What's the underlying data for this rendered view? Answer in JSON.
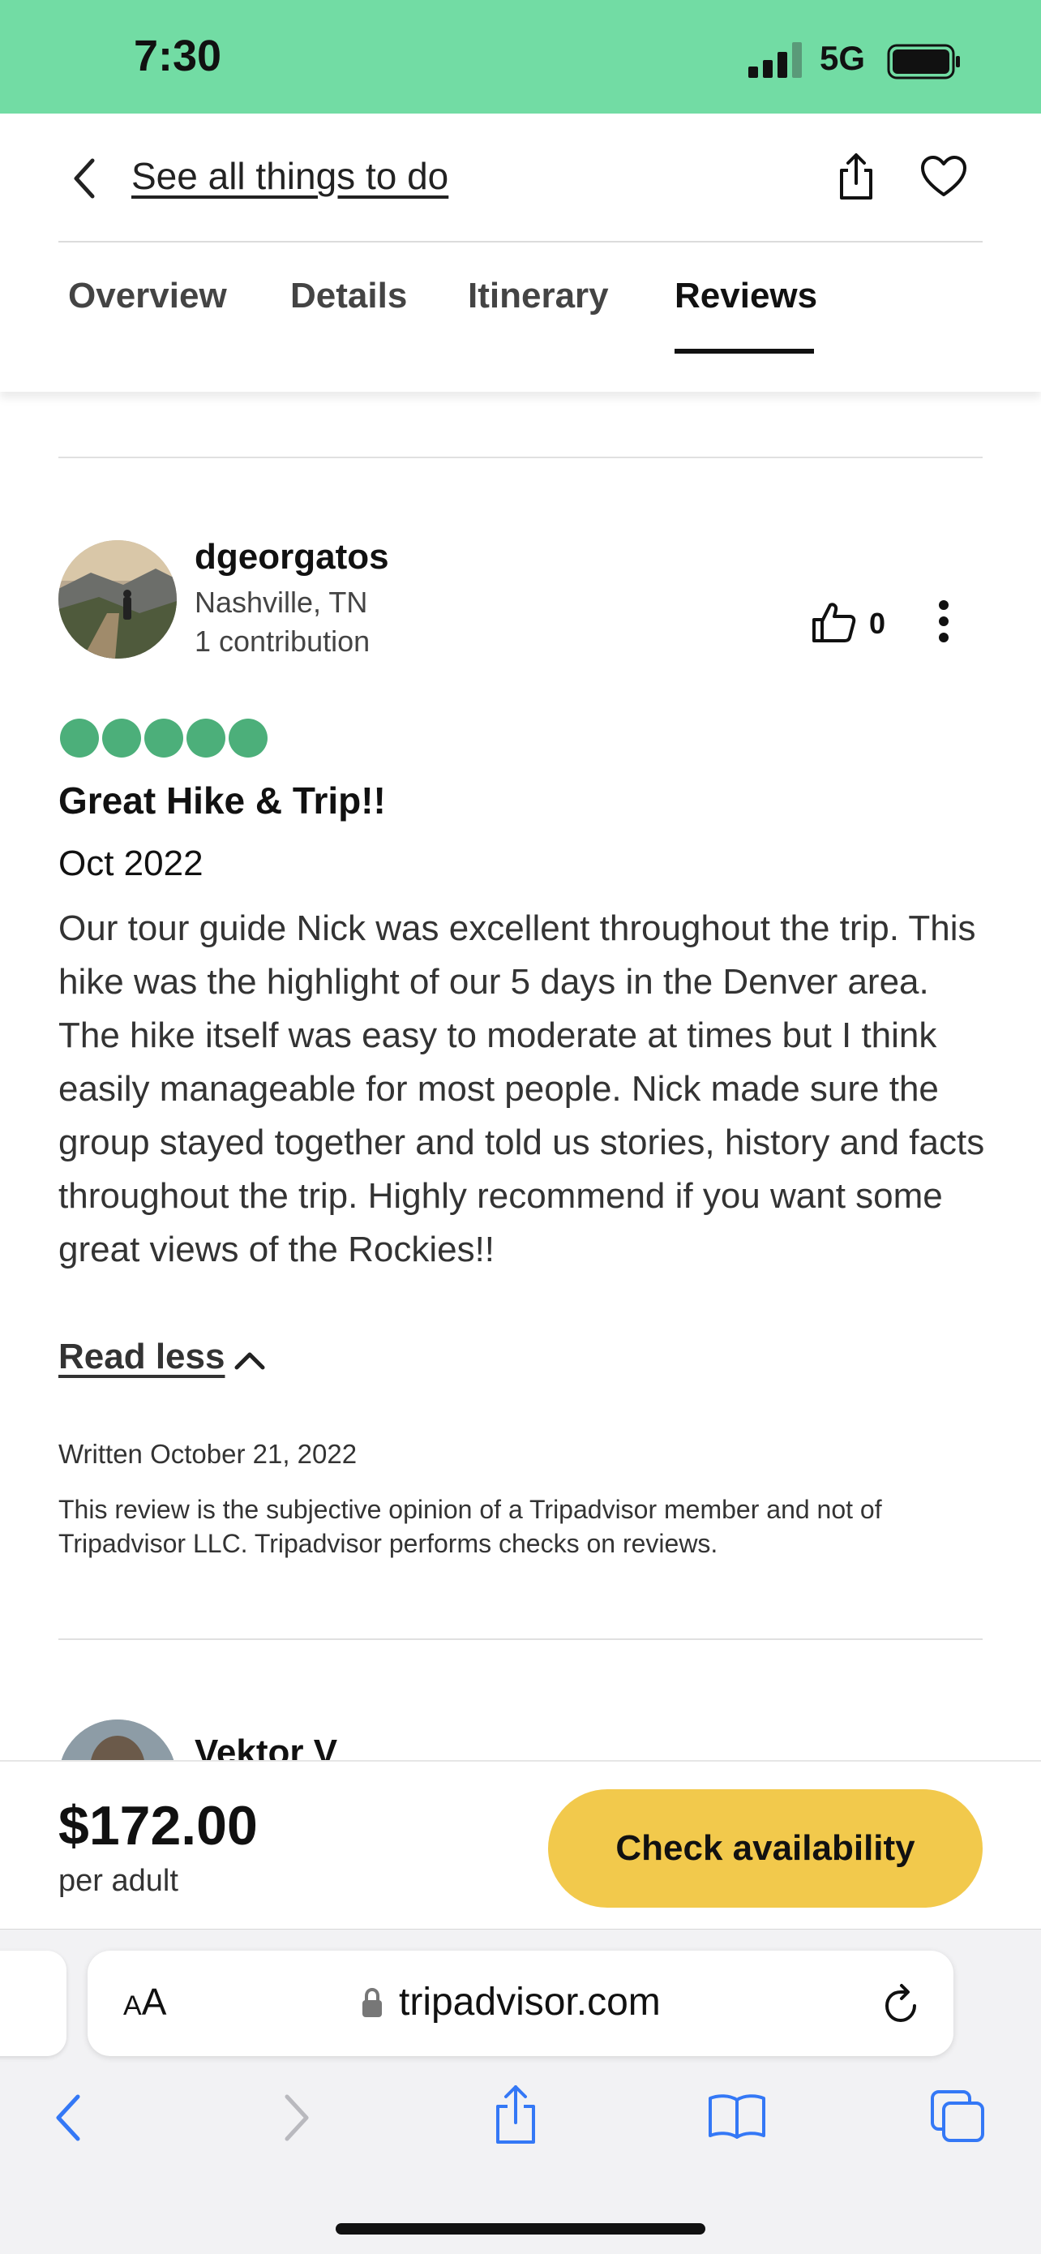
{
  "status_bar": {
    "time": "7:30",
    "network": "5G",
    "background_color": "#72dca4"
  },
  "header": {
    "back_label": "See all things to do",
    "tabs": [
      {
        "label": "Overview",
        "active": false
      },
      {
        "label": "Details",
        "active": false
      },
      {
        "label": "Itinerary",
        "active": false
      },
      {
        "label": "Reviews",
        "active": true
      }
    ]
  },
  "review": {
    "reviewer": {
      "name": "dgeorgatos",
      "location": "Nashville, TN",
      "contributions": "1 contribution"
    },
    "helpful_count": "0",
    "rating": 5,
    "rating_color": "#4caf7a",
    "title": "Great Hike & Trip!!",
    "date": "Oct 2022",
    "body": "Our tour guide Nick was excellent throughout the trip. This hike was the highlight of our 5 days in the Denver area. The hike itself was easy to moderate at times but I think easily manageable for most people. Nick made sure the group stayed together and told us stories, history and facts throughout the trip. Highly recommend if you want some great views of the Rockies!!",
    "read_less_label": "Read less",
    "written": "Written October 21, 2022",
    "disclaimer": "This review is the subjective opinion of a Tripadvisor member and not of Tripadvisor LLC. Tripadvisor performs checks on reviews."
  },
  "next_review": {
    "reviewer_name": "Vektor V"
  },
  "booking": {
    "price": "$172.00",
    "price_unit": "per adult",
    "button_label": "Check availability",
    "button_color": "#f2c94c"
  },
  "safari": {
    "aa_label_small": "A",
    "aa_label_large": "A",
    "url": "tripadvisor.com"
  }
}
